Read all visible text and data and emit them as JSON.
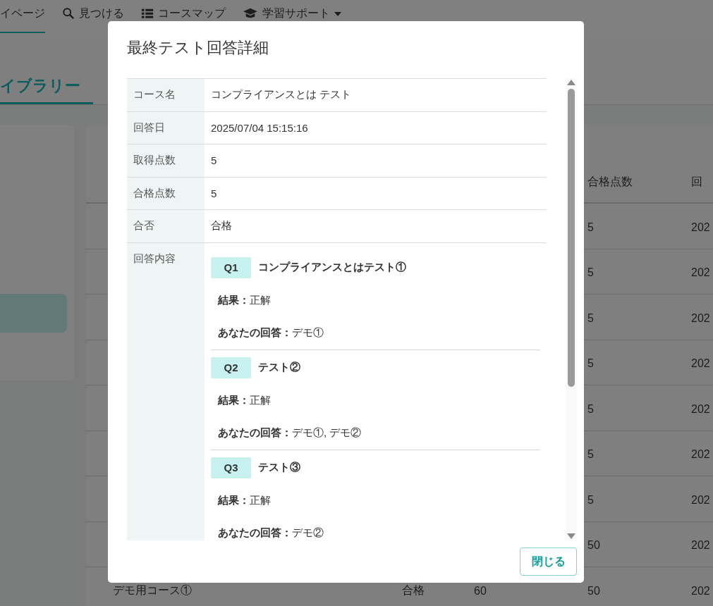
{
  "background": {
    "nav": [
      {
        "label": "イページ",
        "selected": true
      },
      {
        "label": "見つける",
        "selected": false
      },
      {
        "label": "コースマップ"
      },
      {
        "label": "学習サポート",
        "dropdown": true
      }
    ],
    "tab": {
      "label": "イブラリー",
      "selected": true
    },
    "table": {
      "columns": {
        "passing_score": "合格点数",
        "answered": "回"
      },
      "rows": [
        {
          "passing_score": "5",
          "answered": "202"
        },
        {
          "passing_score": "5",
          "answered": "202"
        },
        {
          "passing_score": "5",
          "answered": "202"
        },
        {
          "passing_score": "5",
          "answered": "202"
        },
        {
          "passing_score": "5",
          "answered": "202"
        },
        {
          "passing_score": "5",
          "answered": "202"
        },
        {
          "passing_score": "5",
          "answered": "202"
        },
        {
          "passing_score": "50",
          "answered": "202"
        },
        {
          "course": "デモ用コース①",
          "result": "合格",
          "score": "60",
          "passing_score": "50",
          "answered": "202"
        }
      ]
    }
  },
  "dialog": {
    "title": "最終テスト回答詳細",
    "fields": [
      {
        "label": "コース名",
        "value": "コンプライアンスとは テスト"
      },
      {
        "label": "回答日",
        "value": "2025/07/04 15:15:16"
      },
      {
        "label": "取得点数",
        "value": "5"
      },
      {
        "label": "合格点数",
        "value": "5"
      },
      {
        "label": "合否",
        "value": "合格"
      }
    ],
    "answers_label": "回答内容",
    "answers": [
      {
        "number": "Q1",
        "question": "コンプライアンスとはテスト①",
        "result": "**結果：**正解",
        "your_answer": "**あなたの回答：**デモ①"
      },
      {
        "number": "Q2",
        "question": "テスト②",
        "result": "**結果：**正解",
        "your_answer": "**あなたの回答：**デモ①, デモ②"
      },
      {
        "number": "Q3",
        "question": "テスト③",
        "result": "**結果：**正解",
        "your_answer": "**あなたの回答：**デモ②"
      }
    ],
    "close_button": "閉じる"
  }
}
